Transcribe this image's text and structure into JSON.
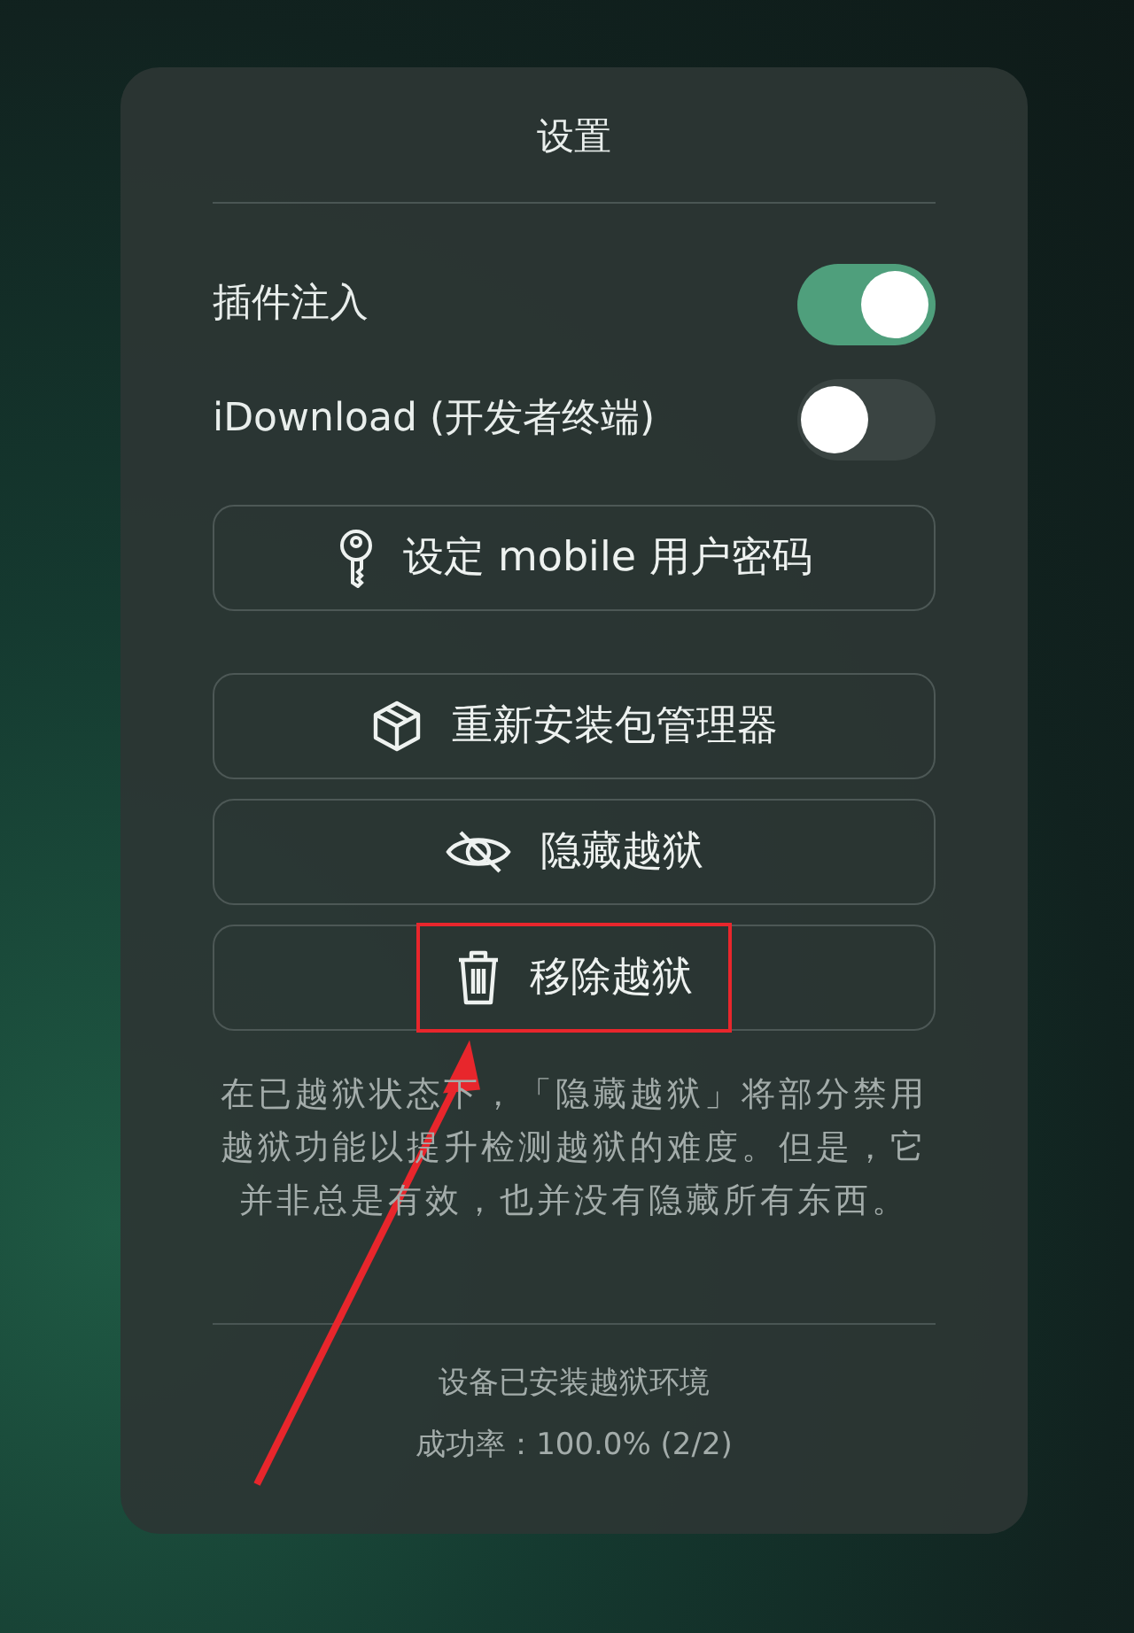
{
  "title": "设置",
  "toggles": [
    {
      "label": "插件注入",
      "on": true
    },
    {
      "label": "iDownload (开发者终端)",
      "on": false
    }
  ],
  "button_groups": [
    [
      {
        "kind": "key",
        "label": "设定 mobile 用户密码",
        "highlighted": false
      }
    ],
    [
      {
        "kind": "package",
        "label": "重新安装包管理器",
        "highlighted": false
      },
      {
        "kind": "eye-slash",
        "label": "隐藏越狱",
        "highlighted": false
      },
      {
        "kind": "trash",
        "label": "移除越狱",
        "highlighted": true
      }
    ]
  ],
  "note": "在已越狱状态下，「隐藏越狱」将部分禁用越狱功能以提升检测越狱的难度。但是，它并非总是有效，也并没有隐藏所有东西。",
  "status": [
    "设备已安装越狱环境",
    "成功率：100.0% (2/2)"
  ]
}
